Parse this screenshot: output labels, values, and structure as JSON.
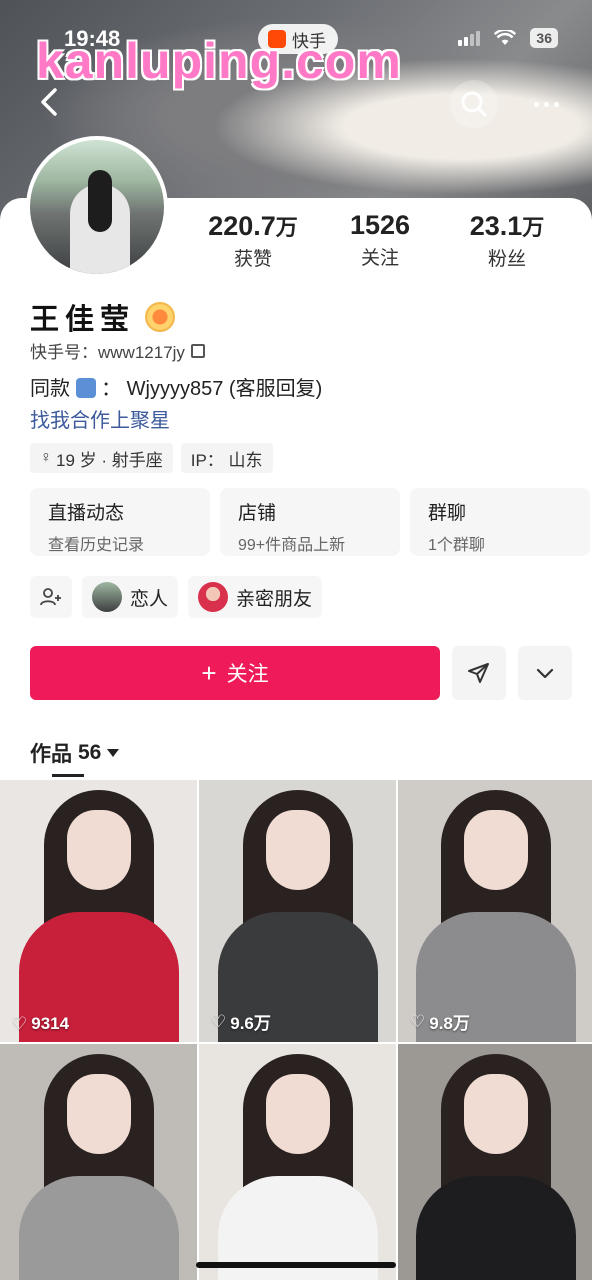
{
  "status_bar": {
    "time": "19:48",
    "app_badge": "快手",
    "battery": "36"
  },
  "watermark": "kanluping.com",
  "profile": {
    "name": "王佳莹",
    "id_label": "快手号：www1217jy",
    "bio_prefix": "同款",
    "bio_text": "：  Wjyyyy857 (客服回复)",
    "link": "找我合作上聚星",
    "tags": [
      "19 岁 · 射手座",
      "IP： 山东"
    ]
  },
  "stats": [
    {
      "num": "220.7",
      "unit": "万",
      "label": "获赞"
    },
    {
      "num": "1526",
      "unit": "",
      "label": "关注"
    },
    {
      "num": "23.1",
      "unit": "万",
      "label": "粉丝"
    }
  ],
  "features": [
    {
      "title": "直播动态",
      "sub": "查看历史记录"
    },
    {
      "title": "店铺",
      "sub": "99+件商品上新"
    },
    {
      "title": "群聊",
      "sub": "1个群聊"
    }
  ],
  "relations": [
    "恋人",
    "亲密朋友"
  ],
  "follow_label": "关注",
  "works": {
    "label": "作品",
    "count": "56"
  },
  "grid": [
    {
      "likes": "9314",
      "bg": "#e9e6e4",
      "shirt": "#c81f3a"
    },
    {
      "likes": "9.6万",
      "bg": "#d9d7d4",
      "shirt": "#3a3b3d"
    },
    {
      "likes": "9.8万",
      "bg": "#cfcbc7",
      "shirt": "#8c8c8e"
    },
    {
      "likes": "",
      "bg": "#bfbcb8",
      "shirt": "#9a9a9a"
    },
    {
      "likes": "",
      "bg": "#e8e4e0",
      "shirt": "#f3f3f3"
    },
    {
      "likes": "",
      "bg": "#9c9894",
      "shirt": "#1d1d1f"
    }
  ],
  "colors": {
    "accent": "#ef1b58",
    "link": "#3d5a9c",
    "watermark": "#ff79c6"
  }
}
